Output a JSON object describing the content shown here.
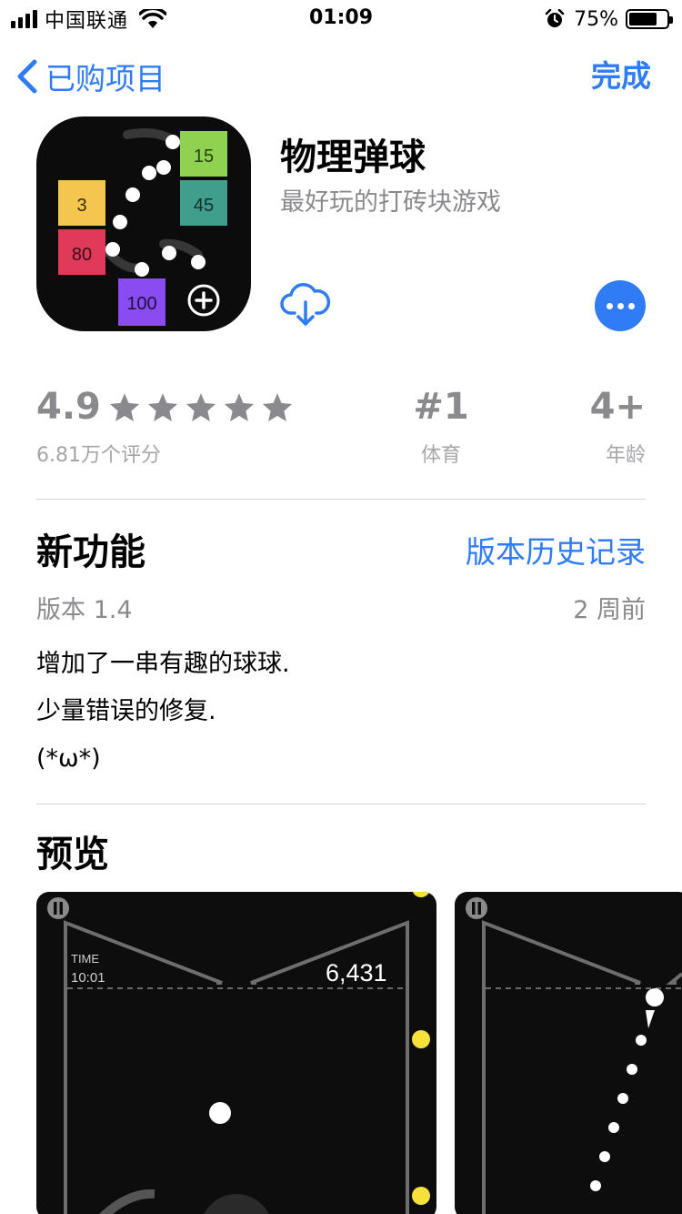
{
  "status_bar": {
    "carrier": "中国联通",
    "time": "01:09",
    "battery_percent": "75%",
    "battery_level": 0.75
  },
  "nav": {
    "back_label": "已购项目",
    "done_label": "完成"
  },
  "app": {
    "title": "物理弹球",
    "subtitle": "最好玩的打砖块游戏",
    "icon_blocks": [
      "15",
      "45",
      "3",
      "80",
      "100"
    ]
  },
  "ratings": {
    "score": "4.9",
    "stars": 5,
    "count": "6.81万个评分",
    "rank": "#1",
    "rank_label": "体育",
    "age": "4+",
    "age_label": "年龄"
  },
  "whats_new": {
    "title": "新功能",
    "history_link": "版本历史记录",
    "version": "版本 1.4",
    "date": "2 周前",
    "notes": [
      "增加了一串有趣的球球.",
      "少量错误的修复.",
      "(*ω*)"
    ]
  },
  "preview": {
    "title": "预览",
    "shot1": {
      "time_label": "TIME",
      "time_value": "10:01",
      "score": "6,431"
    }
  },
  "colors": {
    "accent": "#2f7cf6",
    "secondary_text": "#8a8a8e",
    "block_green": "#8fd24f",
    "block_teal": "#3f9e8c",
    "block_yellow": "#f4c64e",
    "block_red": "#e0395a",
    "block_purple": "#8a4cf0",
    "ball_yellow": "#f5e13a"
  }
}
